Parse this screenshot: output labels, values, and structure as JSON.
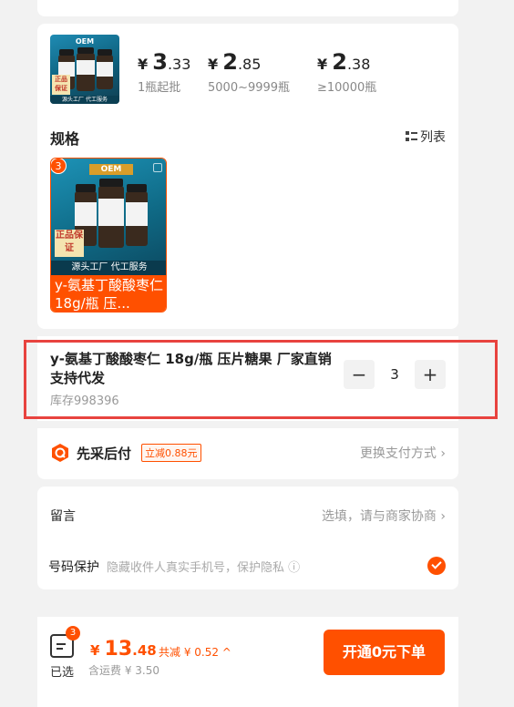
{
  "price_tiers": [
    {
      "currency": "¥",
      "int": "3",
      "dec": ".33",
      "cond": "1瓶起批"
    },
    {
      "currency": "¥",
      "int": "2",
      "dec": ".85",
      "cond": "5000~9999瓶"
    },
    {
      "currency": "¥",
      "int": "2",
      "dec": ".38",
      "cond": "≥10000瓶"
    }
  ],
  "thumb": {
    "oem": "OEM",
    "tag": "正品保证",
    "foot": "源头工厂 代工服务"
  },
  "spec": {
    "title": "规格",
    "list_label": "列表",
    "badge": "3",
    "item_label": "y-氨基丁酸酸枣仁 18g/瓶 压...",
    "img_oem": "OEM",
    "img_tag": "正品保证",
    "img_foot": "源头工厂 代工服务"
  },
  "quantity": {
    "name": "y-氨基丁酸酸枣仁 18g/瓶 压片糖果 厂家直销 支持代发",
    "stock": "库存998396",
    "minus": "−",
    "value": "3",
    "plus": "+"
  },
  "payment": {
    "title": "先采后付",
    "badge": "立减0.88元",
    "switch": "更换支付方式 ›"
  },
  "message": {
    "label": "留言",
    "placeholder": "选填，请与商家协商 ›",
    "protect_label": "号码保护",
    "protect_desc": "隐藏收件人真实手机号，保护隐私 ⓘ"
  },
  "footer": {
    "badge": "3",
    "selected_label": "已选",
    "currency": "¥",
    "total_int": "13",
    "total_dec": ".48",
    "discount": "共减 ¥ 0.52 ^",
    "shipping": "含运费 ¥ 3.50",
    "order_button": "开通0元下单"
  },
  "colors": {
    "accent": "#ff5000",
    "highlight": "#e8433f"
  }
}
